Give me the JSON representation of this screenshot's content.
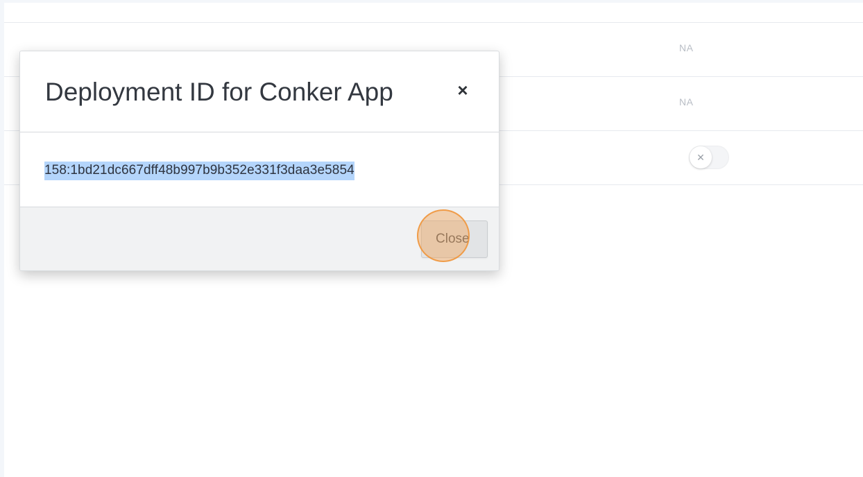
{
  "table": {
    "rows": [
      {
        "status": "NA"
      },
      {
        "status": "NA"
      },
      {
        "toggle_icon": "x-icon"
      }
    ]
  },
  "modal": {
    "title": "Deployment ID for Conker App",
    "close_icon": "×",
    "deployment_id": "158:1bd21dc667dff48b997b9b352e331f3daa3e5854",
    "close_button_label": "Close"
  },
  "colors": {
    "selection_highlight": "#b4d5fb",
    "click_indicator": "#f0a55a"
  }
}
